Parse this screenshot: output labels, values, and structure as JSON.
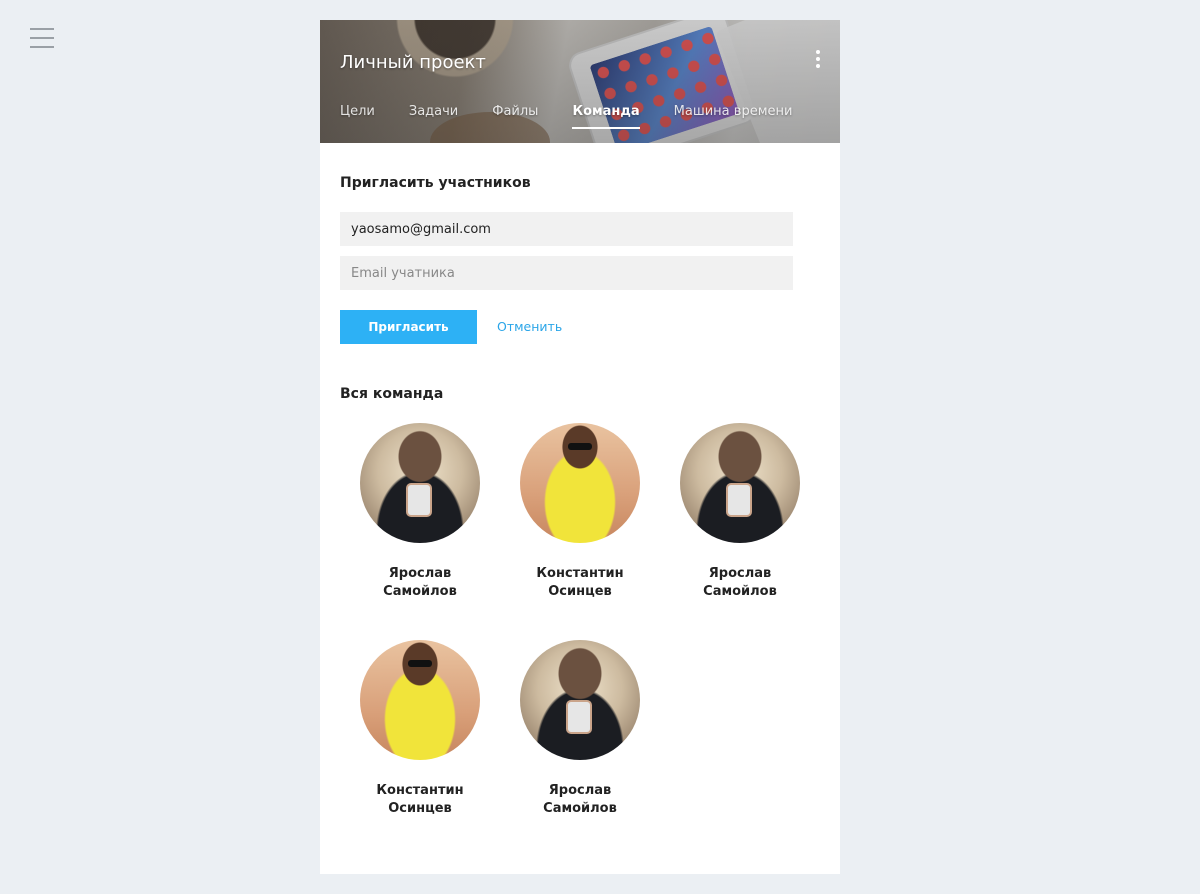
{
  "project": {
    "title": "Личный проект"
  },
  "tabs": [
    {
      "label": "Цели",
      "active": false
    },
    {
      "label": "Задачи",
      "active": false
    },
    {
      "label": "Файлы",
      "active": false
    },
    {
      "label": "Команда",
      "active": true
    },
    {
      "label": "Машина времени",
      "active": false
    }
  ],
  "invite": {
    "heading": "Пригласить участников",
    "email_value": "yaosamo@gmail.com",
    "email_placeholder": "Email учатника",
    "invite_button": "Пригласить",
    "cancel_link": "Отменить"
  },
  "team": {
    "heading": "Вся команда",
    "members": [
      {
        "first": "Ярослав",
        "last": "Самойлов",
        "avatar": "v1"
      },
      {
        "first": "Константин",
        "last": "Осинцев",
        "avatar": "v2"
      },
      {
        "first": "Ярослав",
        "last": "Самойлов",
        "avatar": "v1"
      },
      {
        "first": "Константин",
        "last": "Осинцев",
        "avatar": "v2"
      },
      {
        "first": "Ярослав",
        "last": "Самойлов",
        "avatar": "v1"
      }
    ]
  },
  "colors": {
    "background": "#ebeff3",
    "accent": "#2db1f5",
    "link": "#2aa5e8"
  },
  "icons": {
    "menu": "hamburger-menu-icon",
    "more": "kebab-more-icon"
  }
}
